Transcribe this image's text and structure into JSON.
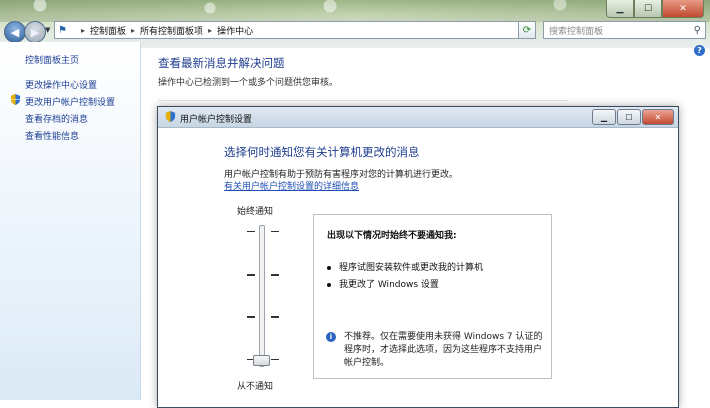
{
  "window": {
    "min_glyph": "▁",
    "max_glyph": "☐",
    "close_glyph": "✕"
  },
  "address": {
    "crumbs": [
      "控制面板",
      "所有控制面板项",
      "操作中心"
    ],
    "search_placeholder": "搜索控制面板"
  },
  "left_panel": {
    "home": "控制面板主页",
    "items": [
      "更改操作中心设置",
      "更改用户帐户控制设置",
      "查看存档的消息",
      "查看性能信息"
    ]
  },
  "main": {
    "title": "查看最新消息并解决问题",
    "subtitle": "操作中心已检测到一个或多个问题供您审核。"
  },
  "dialog": {
    "title": "用户帐户控制设置",
    "heading": "选择何时通知您有关计算机更改的消息",
    "description": "用户帐户控制有助于预防有害程序对您的计算机进行更改。",
    "link": "有关用户帐户控制设置的详细信息",
    "slider": {
      "top_label": "始终通知",
      "bottom_label": "从不通知",
      "levels": 4,
      "selected_level": 0
    },
    "info": {
      "heading": "出现以下情况时始终不要通知我:",
      "bullets": [
        "程序试图安装软件或更改我的计算机",
        "我更改了 Windows 设置"
      ],
      "note": "不推荐。仅在需要使用未获得 Windows 7 认证的程序时，才选择此选项，因为这些程序不支持用户帐户控制。"
    }
  },
  "colors": {
    "link_blue": "#1c3f95",
    "heading_blue": "#1e3d8f"
  }
}
